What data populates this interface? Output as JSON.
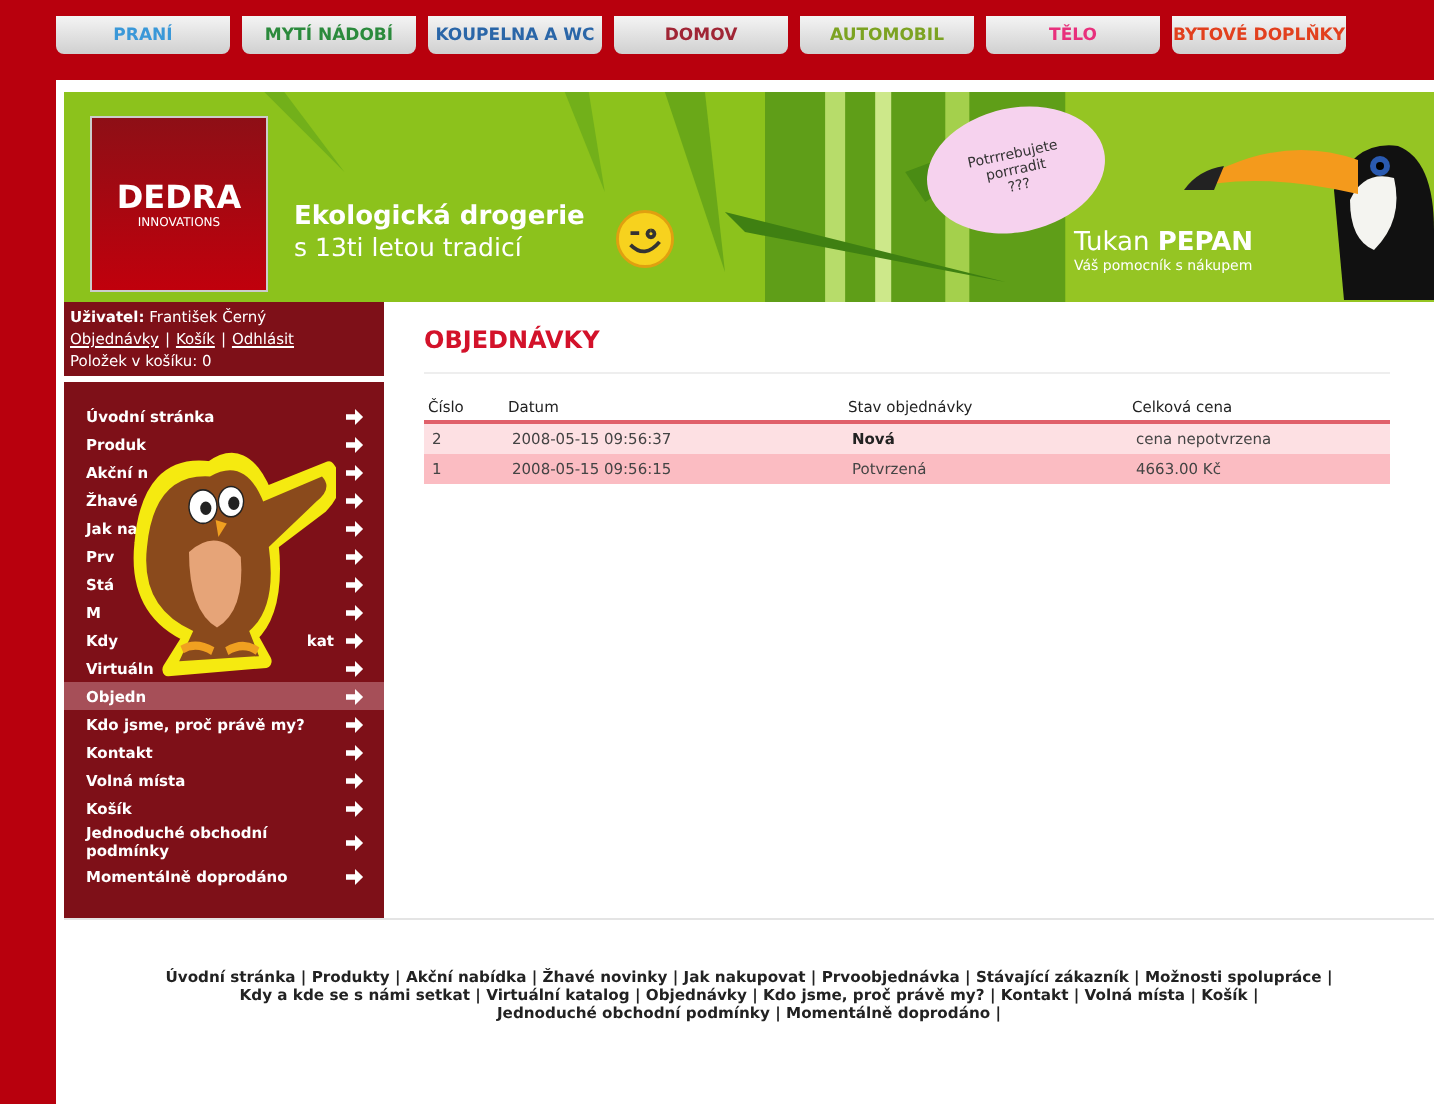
{
  "category_tabs": [
    {
      "label": "PRANÍ",
      "color": "#3a98d8"
    },
    {
      "label": "MYTÍ NÁDOBÍ",
      "color": "#2b8a3c"
    },
    {
      "label": "KOUPELNA A WC",
      "color": "#2a66a8"
    },
    {
      "label": "DOMOV",
      "color": "#a02535"
    },
    {
      "label": "AUTOMOBIL",
      "color": "#7ca322"
    },
    {
      "label": "TĚLO",
      "color": "#e8307c"
    },
    {
      "label": "BYTOVÉ DOPLŇKY",
      "color": "#e2401e"
    }
  ],
  "banner": {
    "logo": "DEDRA",
    "logo_sub": "INNOVATIONS",
    "tagline": "Ekologická drogerie",
    "tagline_sub": "s 13ti letou tradicí",
    "bubble": [
      "Potrrrebujete",
      "porrradit",
      "???"
    ],
    "mascot_name": "Tukan",
    "mascot_name_bold": "PEPAN",
    "mascot_sub": "Váš pomocník s nákupem"
  },
  "user_box": {
    "label": "Uživatel:",
    "name": "František Černý",
    "links": [
      "Objednávky",
      "Košík",
      "Odhlásit"
    ],
    "separator": "|",
    "cart": "Položek v košíku: 0"
  },
  "menu": [
    {
      "text": "Úvodní stránka",
      "selected": false
    },
    {
      "text": "Produk",
      "selected": false
    },
    {
      "text": "Akční n",
      "selected": false
    },
    {
      "text": "Žhavé",
      "selected": false
    },
    {
      "text": "Jak na",
      "selected": false
    },
    {
      "text": "Prv",
      "selected": false
    },
    {
      "text": "Stá",
      "selected": false
    },
    {
      "text": "M",
      "selected": false
    },
    {
      "text": "Kdy",
      "text_end": "kat",
      "selected": false
    },
    {
      "text": "Virtuáln",
      "selected": false
    },
    {
      "text": "Objedn",
      "selected": true
    },
    {
      "text": "Kdo jsme, proč právě my?",
      "selected": false
    },
    {
      "text": "Kontakt",
      "selected": false
    },
    {
      "text": "Volná místa",
      "selected": false
    },
    {
      "text": "Košík",
      "selected": false
    },
    {
      "text": "Jednoduché obchodní podmínky",
      "selected": false
    },
    {
      "text": "Momentálně doprodáno",
      "selected": false
    }
  ],
  "page_title": "OBJEDNÁVKY",
  "table": {
    "columns": [
      "Číslo",
      "Datum",
      "Stav objednávky",
      "Celková cena"
    ],
    "rows": [
      {
        "cells": [
          "2",
          "2008-05-15 09:56:37",
          "Nová",
          "cena nepotvrzena"
        ],
        "status_bold": true,
        "selected": false
      },
      {
        "cells": [
          "1",
          "2008-05-15 09:56:15",
          "Potvrzená",
          "4663.00 Kč"
        ],
        "status_bold": false,
        "selected": true
      }
    ]
  },
  "footer": {
    "separator": "|",
    "links": [
      "Úvodní stránka",
      "Produkty",
      "Akční nabídka",
      "Žhavé novinky",
      "Jak nakupovat",
      "Prvoobjednávka",
      "Stávající zákazník",
      "Možnosti spolupráce",
      "Kdy a kde se s námi setkat",
      "Virtuální katalog",
      "Objednávky",
      "Kdo jsme, proč právě my?",
      "Kontakt",
      "Volná místa",
      "Košík",
      "Jednoduché obchodní podmínky",
      "Momentálně doprodáno"
    ]
  }
}
